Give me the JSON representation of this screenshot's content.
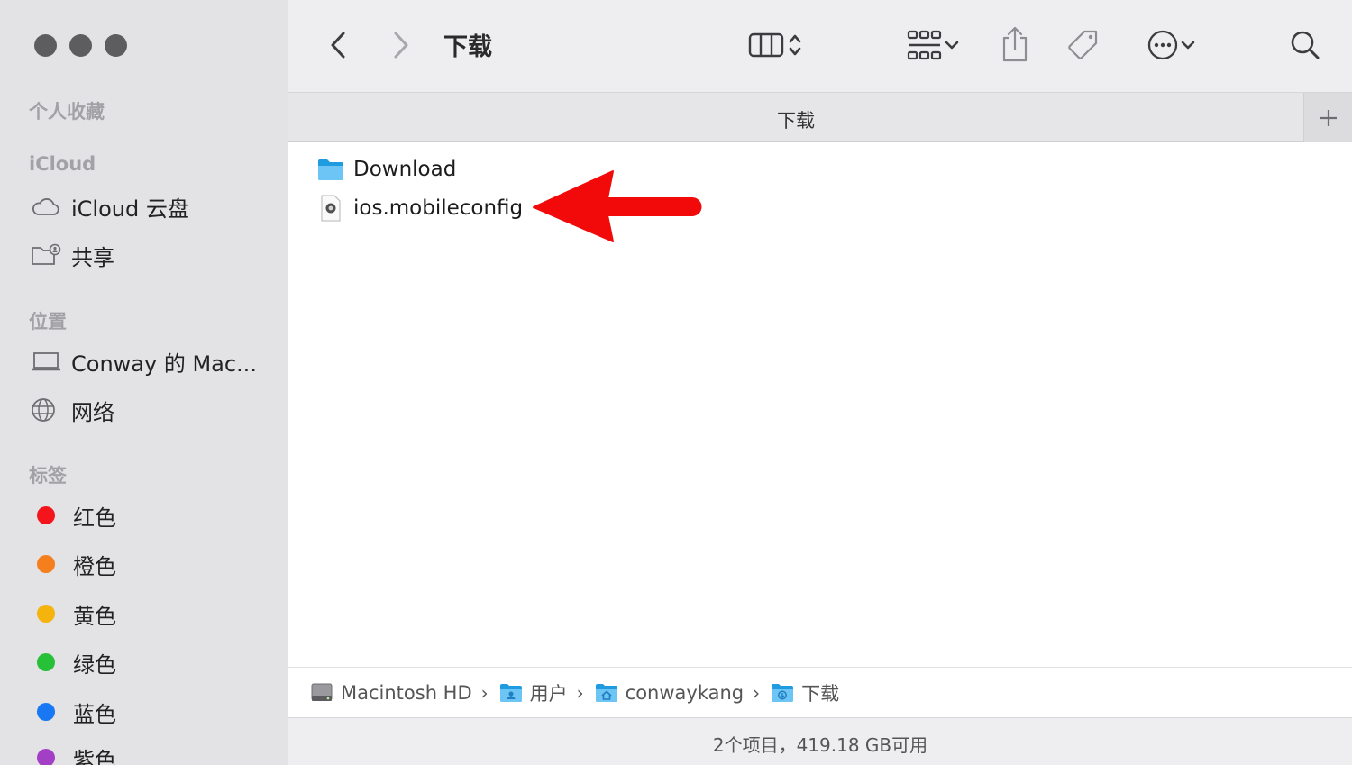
{
  "window": {
    "traffic_lights": [
      "close",
      "minimize",
      "zoom"
    ]
  },
  "sidebar": {
    "sections": {
      "favorites": "个人收藏",
      "icloud": "iCloud",
      "locations": "位置",
      "tags": "标签"
    },
    "icloud_items": [
      {
        "label": "iCloud 云盘",
        "icon": "cloud-icon"
      },
      {
        "label": "共享",
        "icon": "shared-folder-icon"
      }
    ],
    "location_items": [
      {
        "label": "Conway 的 Mac...",
        "icon": "laptop-icon"
      },
      {
        "label": "网络",
        "icon": "globe-icon"
      }
    ],
    "tag_items": [
      {
        "label": "红色",
        "color": "#f3151b"
      },
      {
        "label": "橙色",
        "color": "#f57f1c"
      },
      {
        "label": "黄色",
        "color": "#f5b40d"
      },
      {
        "label": "绿色",
        "color": "#27c138"
      },
      {
        "label": "蓝色",
        "color": "#1877f2"
      },
      {
        "label": "紫色",
        "color": "#a33fc4"
      }
    ]
  },
  "toolbar": {
    "title": "下载",
    "icons": [
      "back-icon",
      "forward-icon",
      "column-view-icon",
      "group-icon",
      "share-icon",
      "tag-icon",
      "more-icon",
      "search-icon"
    ]
  },
  "tab": {
    "label": "下载",
    "add_symbol": "+"
  },
  "files": [
    {
      "name": "Download",
      "icon": "folder-icon"
    },
    {
      "name": "ios.mobileconfig",
      "icon": "config-file-icon"
    }
  ],
  "annotation": {
    "arrow_color": "#f20a0a"
  },
  "path": [
    {
      "label": "Macintosh HD",
      "icon": "drive-icon"
    },
    {
      "label": "用户",
      "icon": "users-folder-icon"
    },
    {
      "label": "conwaykang",
      "icon": "home-folder-icon"
    },
    {
      "label": "下载",
      "icon": "downloads-folder-icon"
    }
  ],
  "path_separator": "›",
  "status": "2个项目，419.18 GB可用"
}
